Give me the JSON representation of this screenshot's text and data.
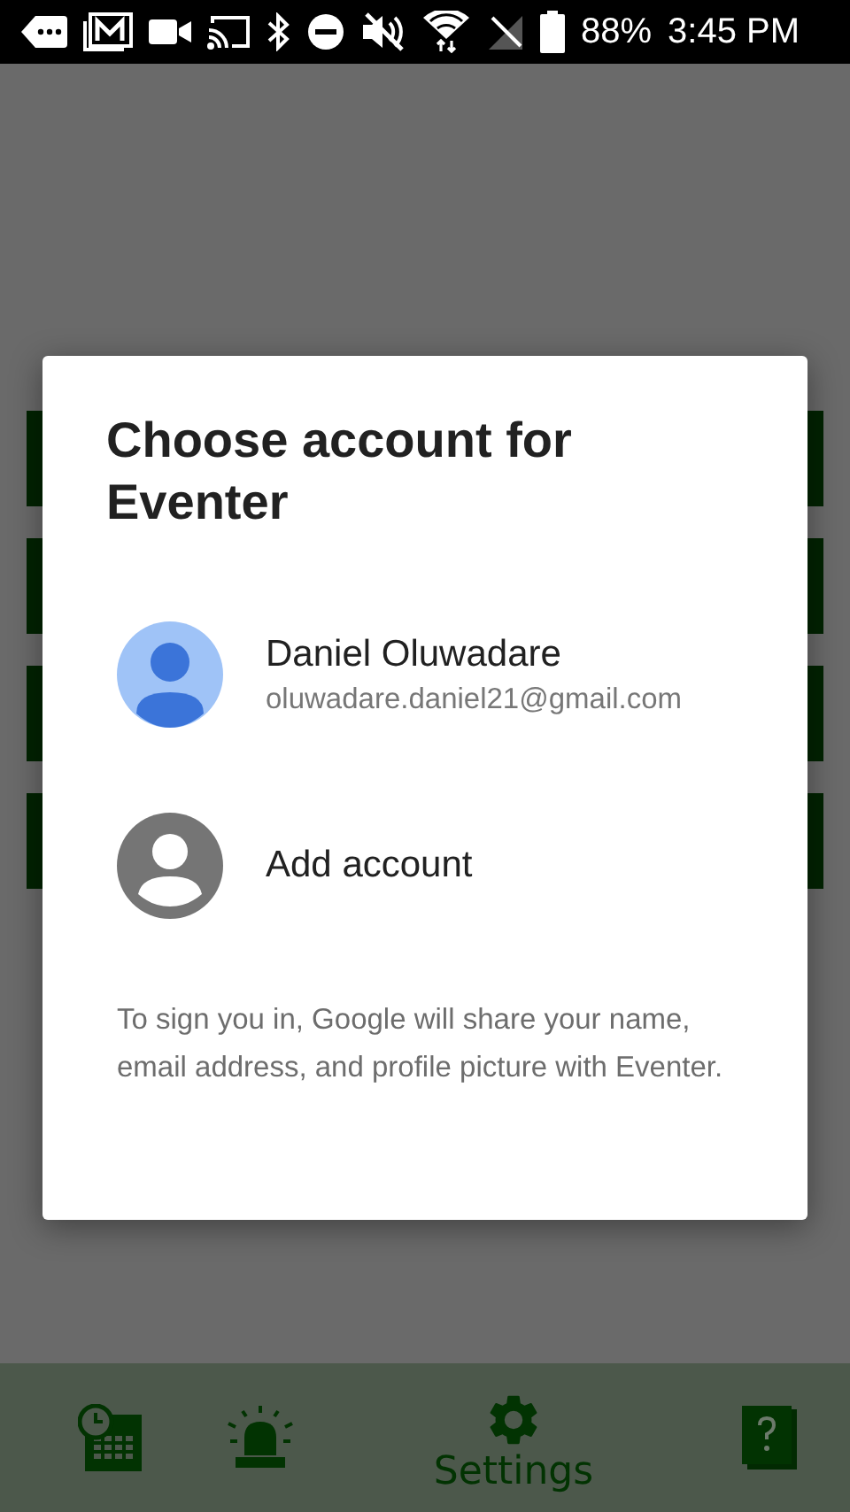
{
  "status_bar": {
    "battery": "88%",
    "time": "3:45 PM"
  },
  "dialog": {
    "title": "Choose account for Eventer",
    "accounts": [
      {
        "kind": "account",
        "name": "Daniel Oluwadare",
        "email": "oluwadare.daniel21@gmail.com"
      },
      {
        "kind": "add",
        "name": "Add account"
      }
    ],
    "notice": "To sign you in, Google will share your name, email address, and profile picture with Eventer."
  },
  "bottom_nav": [
    {
      "kind": "calendar",
      "selected": false
    },
    {
      "kind": "alarm",
      "selected": false
    },
    {
      "kind": "settings",
      "label": "Settings",
      "selected": true
    },
    {
      "kind": "help",
      "selected": false
    }
  ]
}
